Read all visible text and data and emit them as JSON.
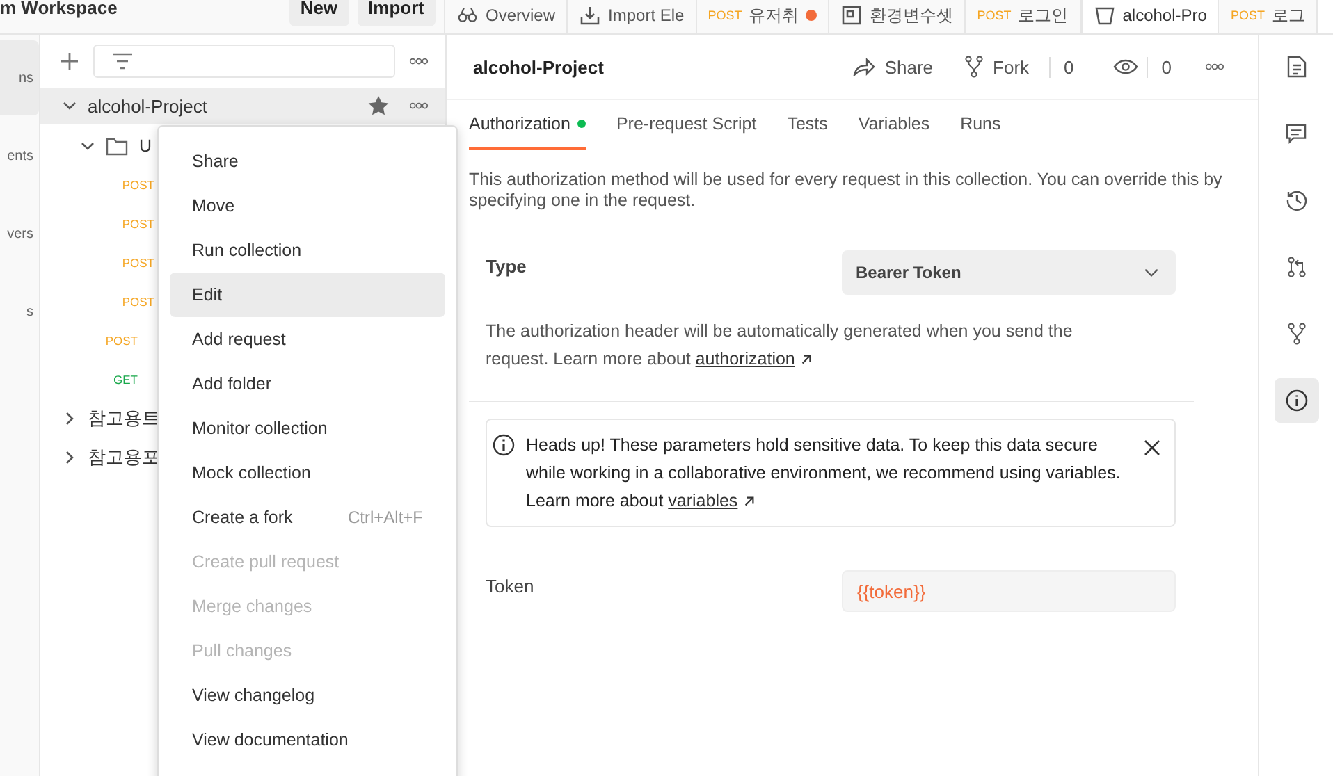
{
  "workspace": {
    "title": "m Workspace",
    "buttons": [
      "New",
      "Import"
    ]
  },
  "rail": [
    {
      "label": "ns",
      "selected": true
    },
    {
      "label": "ents",
      "selected": false
    },
    {
      "label": "vers",
      "selected": false
    },
    {
      "label": "s",
      "selected": false
    }
  ],
  "tabs": [
    {
      "kind": "overview",
      "label": "Overview",
      "selected": false
    },
    {
      "kind": "import",
      "label": "Import Ele",
      "selected": false
    },
    {
      "kind": "request",
      "method": "POST",
      "label": "유저취",
      "unsaved": true,
      "selected": false
    },
    {
      "kind": "environment",
      "label": "환경변수셋",
      "selected": false
    },
    {
      "kind": "request",
      "method": "POST",
      "label": "로그인",
      "unsaved": false,
      "selected": false
    },
    {
      "kind": "collection",
      "label": "alcohol-Pro",
      "selected": true
    },
    {
      "kind": "request",
      "method": "POST",
      "label": "로그",
      "unsaved": false,
      "selected": false
    }
  ],
  "sidebar": {
    "items": [
      {
        "kind": "collection",
        "name": "alcohol-Project",
        "expanded": true,
        "starred": true,
        "children": [
          {
            "kind": "folder",
            "name": "U",
            "expanded": true,
            "children": [
              {
                "kind": "request",
                "method": "POST"
              },
              {
                "kind": "request",
                "method": "POST"
              },
              {
                "kind": "request",
                "method": "POST"
              },
              {
                "kind": "request",
                "method": "POST"
              }
            ]
          },
          {
            "kind": "request",
            "method": "POST"
          },
          {
            "kind": "request",
            "method": "GET"
          }
        ]
      },
      {
        "kind": "collection",
        "name": "참고용트",
        "expanded": false
      },
      {
        "kind": "collection",
        "name": "참고용포",
        "expanded": false
      }
    ]
  },
  "menu": [
    {
      "label": "Share",
      "selected": false,
      "disabled": false
    },
    {
      "label": "Move",
      "selected": false,
      "disabled": false
    },
    {
      "label": "Run collection",
      "selected": false,
      "disabled": false
    },
    {
      "label": "Edit",
      "selected": true,
      "disabled": false
    },
    {
      "label": "Add request",
      "selected": false,
      "disabled": false
    },
    {
      "label": "Add folder",
      "selected": false,
      "disabled": false
    },
    {
      "label": "Monitor collection",
      "selected": false,
      "disabled": false
    },
    {
      "label": "Mock collection",
      "selected": false,
      "disabled": false
    },
    {
      "label": "Create a fork",
      "shortcut": "Ctrl+Alt+F",
      "selected": false,
      "disabled": false
    },
    {
      "label": "Create pull request",
      "selected": false,
      "disabled": true
    },
    {
      "label": "Merge changes",
      "selected": false,
      "disabled": true
    },
    {
      "label": "Pull changes",
      "selected": false,
      "disabled": true
    },
    {
      "label": "View changelog",
      "selected": false,
      "disabled": false
    },
    {
      "label": "View documentation",
      "selected": false,
      "disabled": false
    }
  ],
  "collection": {
    "title": "alcohol-Project",
    "share": "Share",
    "fork": "Fork",
    "fork_count": "0",
    "watch_count": "0",
    "tabs": [
      {
        "label": "Authorization",
        "selected": true,
        "dot": true
      },
      {
        "label": "Pre-request Script",
        "selected": false,
        "dot": false
      },
      {
        "label": "Tests",
        "selected": false,
        "dot": false
      },
      {
        "label": "Variables",
        "selected": false,
        "dot": false
      },
      {
        "label": "Runs",
        "selected": false,
        "dot": false
      }
    ],
    "description": "This authorization method will be used for every request in this collection. You can override this by specifying one in the request.",
    "type_label": "Type",
    "type_value": "Bearer Token",
    "type_help": {
      "text": "The authorization header will be automatically generated when you send the request. Learn more about",
      "link": "authorization"
    },
    "alert": {
      "text": "Heads up! These parameters hold sensitive data. To keep this data secure while working in a collaborative environment, we recommend using variables. Learn more about",
      "link": "variables"
    },
    "token_label": "Token",
    "token_value": "{{token}}"
  },
  "right_rail": [
    {
      "kind": "document",
      "selected": false
    },
    {
      "kind": "comment",
      "selected": false
    },
    {
      "kind": "history",
      "selected": false
    },
    {
      "kind": "pull-request",
      "selected": false
    },
    {
      "kind": "fork",
      "selected": false
    },
    {
      "kind": "info",
      "selected": true
    }
  ]
}
